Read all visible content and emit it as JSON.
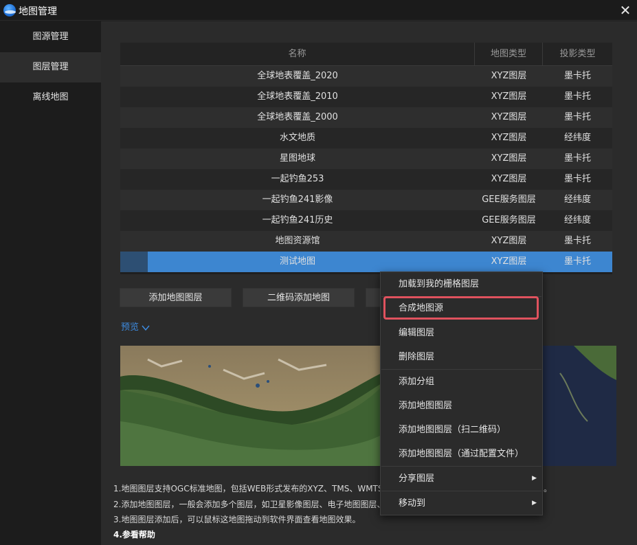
{
  "window": {
    "title": "地图管理",
    "close_glyph": "✕",
    "app_icon": "earth-logo-icon"
  },
  "sidebar": {
    "items": [
      {
        "label": "图源管理"
      },
      {
        "label": "图层管理",
        "active": true
      },
      {
        "label": "离线地图"
      }
    ]
  },
  "table": {
    "headers": [
      "名称",
      "地图类型",
      "投影类型"
    ],
    "rows": [
      {
        "name": "全球地表覆盖_2020",
        "type": "XYZ图层",
        "projection": "墨卡托"
      },
      {
        "name": "全球地表覆盖_2010",
        "type": "XYZ图层",
        "projection": "墨卡托"
      },
      {
        "name": "全球地表覆盖_2000",
        "type": "XYZ图层",
        "projection": "墨卡托"
      },
      {
        "name": "水文地质",
        "type": "XYZ图层",
        "projection": "经纬度"
      },
      {
        "name": "星图地球",
        "type": "XYZ图层",
        "projection": "墨卡托"
      },
      {
        "name": "一起钓鱼253",
        "type": "XYZ图层",
        "projection": "墨卡托"
      },
      {
        "name": "一起钓鱼241影像",
        "type": "GEE服务图层",
        "projection": "经纬度"
      },
      {
        "name": "一起钓鱼241历史",
        "type": "GEE服务图层",
        "projection": "经纬度"
      },
      {
        "name": "地图资源馆",
        "type": "XYZ图层",
        "projection": "墨卡托"
      },
      {
        "name": "测试地图",
        "type": "XYZ图层",
        "projection": "墨卡托",
        "selected": true
      }
    ]
  },
  "buttons": {
    "add_layer": "添加地图图层",
    "qr_add": "二维码添加地图"
  },
  "preview": {
    "label": "预览",
    "chevron_icon": "chevron-down-icon"
  },
  "help": [
    "1.地图图层支持OGC标准地图，包括WEB形式发布的XYZ、TMS、WMTS",
    "2.添加地图图层，一般会添加多个图层，如卫星影像图层、电子地图图层、",
    "3.地图图层添加后，可以鼠标这地图拖动到软件界面查看地图效果。",
    "4.参看帮助"
  ],
  "help_trailing": "。",
  "context_menu": {
    "items": [
      {
        "label": "加载到我的栅格图层"
      },
      {
        "label": "合成地图源",
        "highlighted": true
      },
      {
        "label": "编辑图层"
      },
      {
        "label": "删除图层"
      },
      {
        "label": "添加分组"
      },
      {
        "label": "添加地图图层"
      },
      {
        "label": "添加地图图层（扫二维码）"
      },
      {
        "label": "添加地图图层（通过配置文件）"
      },
      {
        "label": "分享图层",
        "submenu": true
      },
      {
        "label": "移动到",
        "submenu": true
      }
    ],
    "submenu_glyph": "▶"
  },
  "colors": {
    "accent": "#3d86d0",
    "highlight_border": "#e0525e",
    "link": "#3d8be0"
  }
}
